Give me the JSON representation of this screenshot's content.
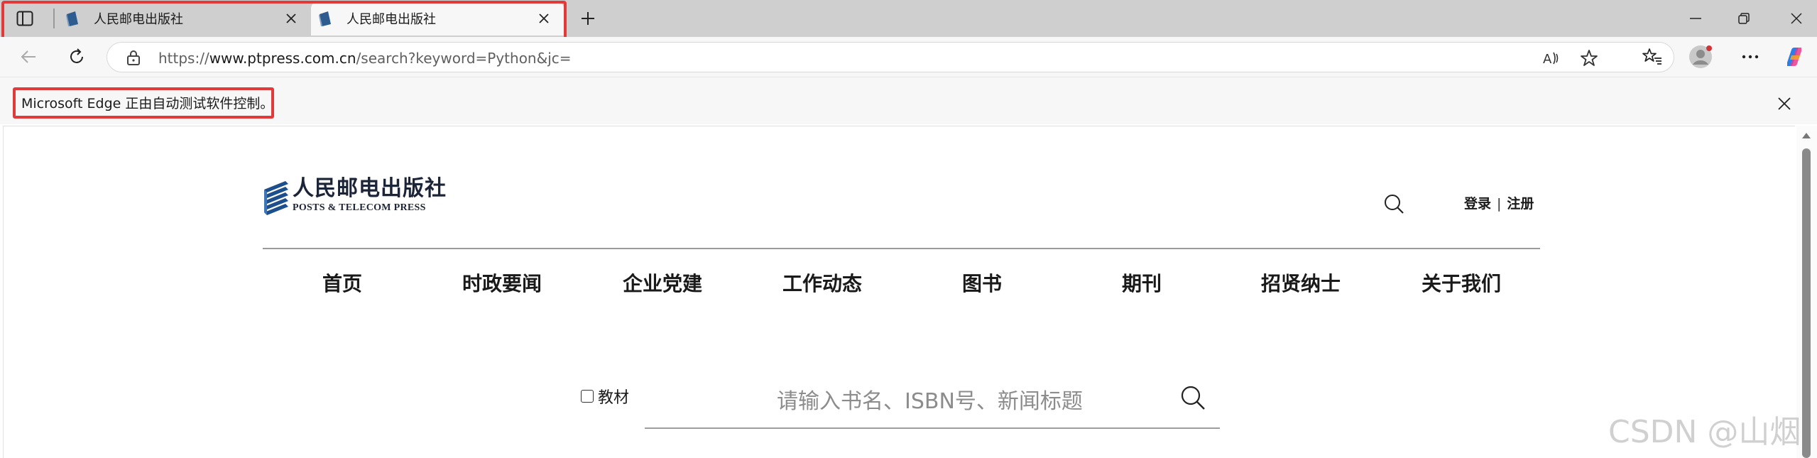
{
  "browser": {
    "tabs": [
      {
        "title": "人民邮电出版社",
        "active": false
      },
      {
        "title": "人民邮电出版社",
        "active": true
      }
    ],
    "address": {
      "scheme": "https://",
      "host": "www.ptpress.com.cn",
      "path": "/search?keyword=Python&jc="
    },
    "infobar_message": "Microsoft Edge 正由自动测试软件控制。",
    "colors": {
      "highlight": "#e03a3a",
      "tabbar": "#cfcfcf",
      "toolbar": "#f7f7f7"
    }
  },
  "site": {
    "logo": {
      "cn": "人民邮电出版社",
      "en": "POSTS & TELECOM PRESS"
    },
    "auth": {
      "login": "登录",
      "divider": "|",
      "register": "注册"
    },
    "nav": [
      {
        "label": "首页"
      },
      {
        "label": "时政要闻"
      },
      {
        "label": "企业党建"
      },
      {
        "label": "工作动态"
      },
      {
        "label": "图书"
      },
      {
        "label": "期刊"
      },
      {
        "label": "招贤纳士"
      },
      {
        "label": "关于我们"
      }
    ],
    "search": {
      "checkbox_label": "教材",
      "checkbox_checked": false,
      "placeholder": "请输入书名、ISBN号、新闻标题"
    },
    "watermark": "CSDN @山烟"
  }
}
